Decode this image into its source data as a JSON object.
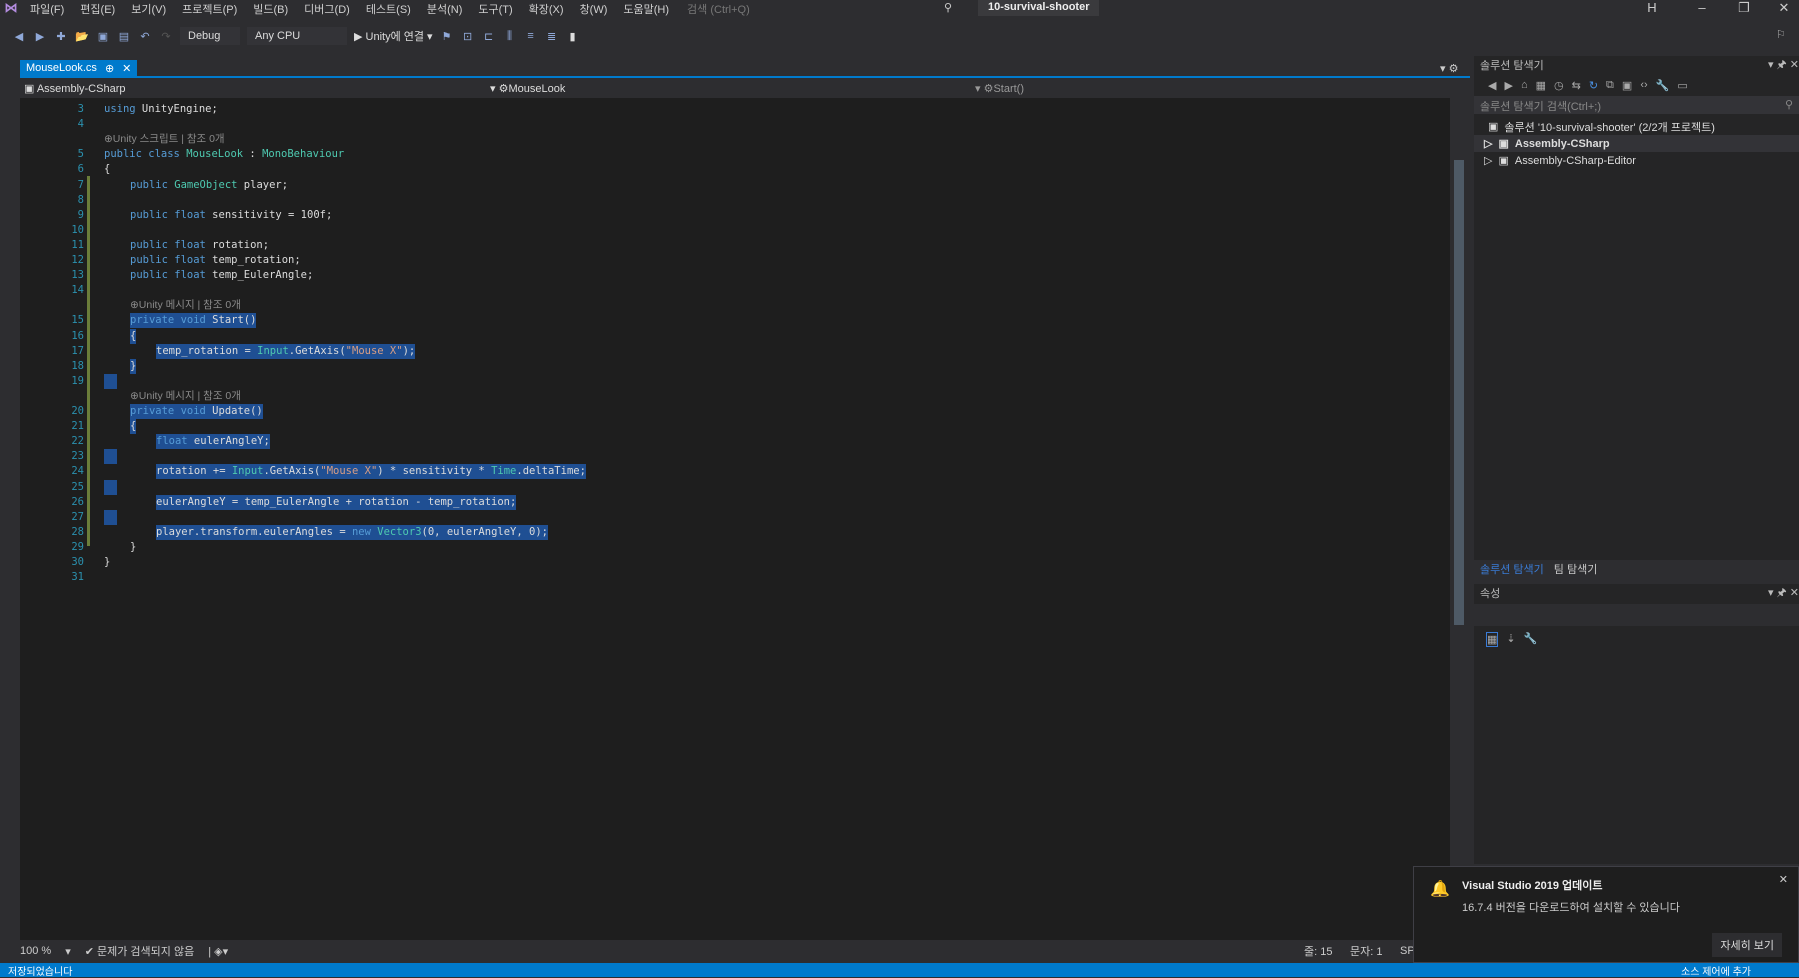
{
  "menu": {
    "items": [
      "파일(F)",
      "편집(E)",
      "보기(V)",
      "프로젝트(P)",
      "빌드(B)",
      "디버그(D)",
      "테스트(S)",
      "분석(N)",
      "도구(T)",
      "확장(X)",
      "창(W)",
      "도움말(H)"
    ],
    "search_placeholder": "검색 (Ctrl+Q)",
    "project_title": "10-survival-shooter",
    "user_initial": "H"
  },
  "toolbar": {
    "config": "Debug",
    "platform": "Any CPU",
    "run_label": "Unity에 연결"
  },
  "tab": {
    "label": "MouseLook.cs",
    "pin": "⊕",
    "close": "✕"
  },
  "nav": {
    "project": "Assembly-CSharp",
    "class": "MouseLook",
    "member": "Start()"
  },
  "code": {
    "lines": [
      {
        "n": "3",
        "tokens": [
          {
            "t": "using",
            "k": "kw"
          },
          {
            "t": " UnityEngine;",
            "k": "pl"
          }
        ]
      },
      {
        "n": "4",
        "tokens": []
      },
      {
        "n": "",
        "lens": "⊕Unity 스크립트 | 참조 0개",
        "indent": 0
      },
      {
        "n": "5",
        "tokens": [
          {
            "t": "public class ",
            "k": "kw"
          },
          {
            "t": "MouseLook",
            "k": "ty"
          },
          {
            "t": " : ",
            "k": "pl"
          },
          {
            "t": "MonoBehaviour",
            "k": "ty"
          }
        ]
      },
      {
        "n": "6",
        "tokens": [
          {
            "t": "{",
            "k": "pl"
          }
        ]
      },
      {
        "n": "7",
        "indent": 1,
        "tokens": [
          {
            "t": "public ",
            "k": "kw"
          },
          {
            "t": "GameObject",
            "k": "ty"
          },
          {
            "t": " player;",
            "k": "pl"
          }
        ]
      },
      {
        "n": "8",
        "tokens": []
      },
      {
        "n": "9",
        "indent": 1,
        "tokens": [
          {
            "t": "public float",
            "k": "kw"
          },
          {
            "t": " sensitivity = 100f;",
            "k": "pl"
          }
        ]
      },
      {
        "n": "10",
        "tokens": []
      },
      {
        "n": "11",
        "indent": 1,
        "tokens": [
          {
            "t": "public float",
            "k": "kw"
          },
          {
            "t": " rotation;",
            "k": "pl"
          }
        ]
      },
      {
        "n": "12",
        "indent": 1,
        "tokens": [
          {
            "t": "public float",
            "k": "kw"
          },
          {
            "t": " temp_rotation;",
            "k": "pl"
          }
        ]
      },
      {
        "n": "13",
        "indent": 1,
        "tokens": [
          {
            "t": "public float",
            "k": "kw"
          },
          {
            "t": " temp_EulerAngle;",
            "k": "pl"
          }
        ]
      },
      {
        "n": "14",
        "tokens": []
      },
      {
        "n": "",
        "lens": "⊕Unity 메시지 | 참조 0개",
        "indent": 1
      },
      {
        "n": "15",
        "indent": 1,
        "sel": true,
        "tokens": [
          {
            "t": "private void",
            "k": "kw"
          },
          {
            "t": " Start()",
            "k": "pl"
          }
        ]
      },
      {
        "n": "16",
        "indent": 1,
        "sel": true,
        "tokens": [
          {
            "t": "{",
            "k": "pl"
          }
        ]
      },
      {
        "n": "17",
        "indent": 2,
        "sel": true,
        "tokens": [
          {
            "t": "temp_rotation = ",
            "k": "pl"
          },
          {
            "t": "Input",
            "k": "ty"
          },
          {
            "t": ".GetAxis(",
            "k": "pl"
          },
          {
            "t": "\"Mouse X\"",
            "k": "st"
          },
          {
            "t": ");",
            "k": "pl"
          }
        ]
      },
      {
        "n": "18",
        "indent": 1,
        "sel": true,
        "tokens": [
          {
            "t": "}",
            "k": "pl"
          }
        ]
      },
      {
        "n": "19",
        "sel": true,
        "tokens": []
      },
      {
        "n": "",
        "lens": "⊕Unity 메시지 | 참조 0개",
        "indent": 1
      },
      {
        "n": "20",
        "indent": 1,
        "sel": true,
        "tokens": [
          {
            "t": "private void",
            "k": "kw"
          },
          {
            "t": " Update()",
            "k": "pl"
          }
        ]
      },
      {
        "n": "21",
        "indent": 1,
        "sel": true,
        "tokens": [
          {
            "t": "{",
            "k": "pl"
          }
        ]
      },
      {
        "n": "22",
        "indent": 2,
        "sel": true,
        "tokens": [
          {
            "t": "float",
            "k": "kw"
          },
          {
            "t": " eulerAngleY;",
            "k": "pl"
          }
        ]
      },
      {
        "n": "23",
        "sel": true,
        "tokens": []
      },
      {
        "n": "24",
        "indent": 2,
        "sel": true,
        "tokens": [
          {
            "t": "rotation += ",
            "k": "pl"
          },
          {
            "t": "Input",
            "k": "ty"
          },
          {
            "t": ".GetAxis(",
            "k": "pl"
          },
          {
            "t": "\"Mouse X\"",
            "k": "st"
          },
          {
            "t": ") * sensitivity * ",
            "k": "pl"
          },
          {
            "t": "Time",
            "k": "ty"
          },
          {
            "t": ".deltaTime;",
            "k": "pl"
          }
        ]
      },
      {
        "n": "25",
        "sel": true,
        "tokens": []
      },
      {
        "n": "26",
        "indent": 2,
        "sel": true,
        "tokens": [
          {
            "t": "eulerAngleY = temp_EulerAngle + rotation - temp_rotation;",
            "k": "pl"
          }
        ]
      },
      {
        "n": "27",
        "sel": true,
        "tokens": []
      },
      {
        "n": "28",
        "indent": 2,
        "sel": true,
        "tokens": [
          {
            "t": "player.transform.eulerAngles = ",
            "k": "pl"
          },
          {
            "t": "new ",
            "k": "kw"
          },
          {
            "t": "Vector3",
            "k": "ty"
          },
          {
            "t": "(0, eulerAngleY, 0);",
            "k": "pl"
          }
        ]
      },
      {
        "n": "29",
        "indent": 1,
        "tokens": [
          {
            "t": "}",
            "k": "pl"
          }
        ]
      },
      {
        "n": "30",
        "tokens": [
          {
            "t": "}",
            "k": "pl"
          }
        ]
      },
      {
        "n": "31",
        "tokens": []
      }
    ]
  },
  "editor_status": {
    "zoom": "100 %",
    "issues": "문제가 검색되지 않음",
    "line": "줄: 15",
    "col": "문자: 1",
    "mode": "SP"
  },
  "solution": {
    "title": "솔루션 탐색기",
    "search_placeholder": "솔루션 탐색기 검색(Ctrl+;)",
    "root": "솔루션 '10-survival-shooter' (2/2개 프로젝트)",
    "projects": [
      "Assembly-CSharp",
      "Assembly-CSharp-Editor"
    ],
    "tabs": [
      "솔루션 탐색기",
      "팀 탐색기"
    ]
  },
  "properties": {
    "title": "속성"
  },
  "notification": {
    "title": "Visual Studio 2019 업데이트",
    "message": "16.7.4 버전을 다운로드하여 설치할 수 있습니다",
    "button": "자세히 보기",
    "close": "✕"
  },
  "statusbar": {
    "left": "저장되었습니다",
    "right": "소스 제어에 추가"
  }
}
